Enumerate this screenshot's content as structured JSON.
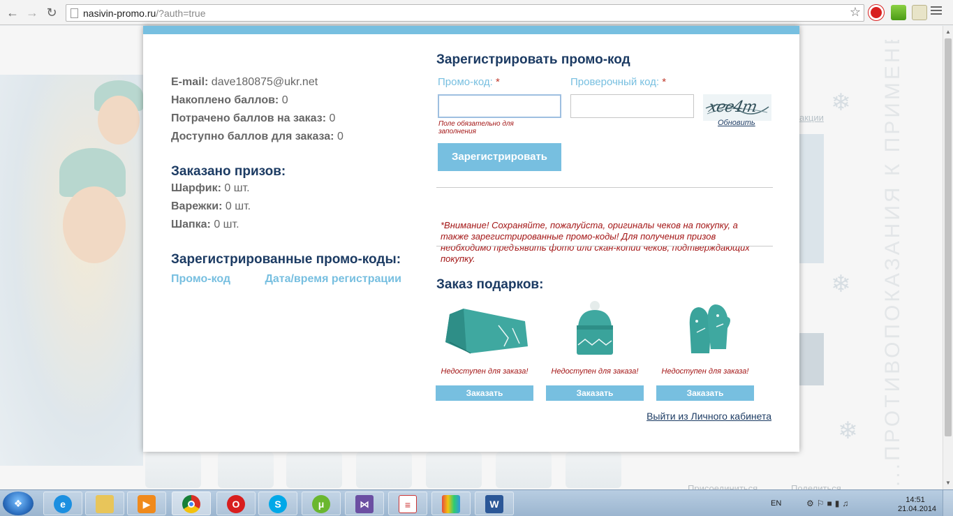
{
  "browser": {
    "url_host": "nasivin-promo.ru",
    "url_query": "/?auth=true"
  },
  "account": {
    "email_label": "E-mail:",
    "email_value": "dave180875@ukr.net",
    "earned_label": "Накоплено баллов:",
    "earned_value": "0",
    "spent_label": "Потрачено баллов на заказ:",
    "spent_value": "0",
    "available_label": "Доступно баллов для заказа:",
    "available_value": "0"
  },
  "prizes": {
    "title": "Заказано призов:",
    "items": [
      {
        "label": "Шарфик:",
        "value": "0 шт."
      },
      {
        "label": "Варежки:",
        "value": "0 шт."
      },
      {
        "label": "Шапка:",
        "value": "0 шт."
      }
    ]
  },
  "codes": {
    "title": "Зарегистрированные промо-коды:",
    "col_code": "Промо-код",
    "col_datetime": "Дата/время регистрации"
  },
  "register": {
    "title": "Зарегистрировать промо-код",
    "promo_label": "Промо-код:",
    "check_label": "Проверочный код:",
    "required_mark": "*",
    "promo_value": "",
    "check_value": "",
    "error_text": "Поле обязательно для заполнения",
    "captcha_text": "xee4m",
    "refresh_label": "Обновить",
    "button_label": "Зарегистрировать",
    "warning": "*Внимание! Сохраняйте, пожалуйста, оригиналы чеков на покупку, а также зарегистрированные промо-коды! Для получения призов необходимо предъявить фото или скан-копии чеков, подтверждающих покупку."
  },
  "gifts": {
    "title": "Заказ подарков:",
    "items": [
      {
        "status": "Недоступен для заказа!",
        "button": "Заказать"
      },
      {
        "status": "Недоступен для заказа!",
        "button": "Заказать"
      },
      {
        "status": "Недоступен для заказа!",
        "button": "Заказать"
      }
    ]
  },
  "logout_label": "Выйти из Личного кабинета",
  "background": {
    "footer_join": "Присоединиться",
    "footer_share": "Поделиться",
    "side_link": "акции",
    "vertical_text": "...ПРОТИВОПОКАЗАНИЯ К ПРИМЕНЕНИЮ ОЗНАКОМЬТЕСЬ С ИНСТРУКЦИЕЙ ПО ПРИМЕНЕНИЮ"
  },
  "taskbar": {
    "language": "EN",
    "time": "14:51",
    "date": "21.04.2014"
  },
  "colors": {
    "accent": "#77bfe0",
    "heading": "#1c3b63",
    "error": "#a31515"
  }
}
